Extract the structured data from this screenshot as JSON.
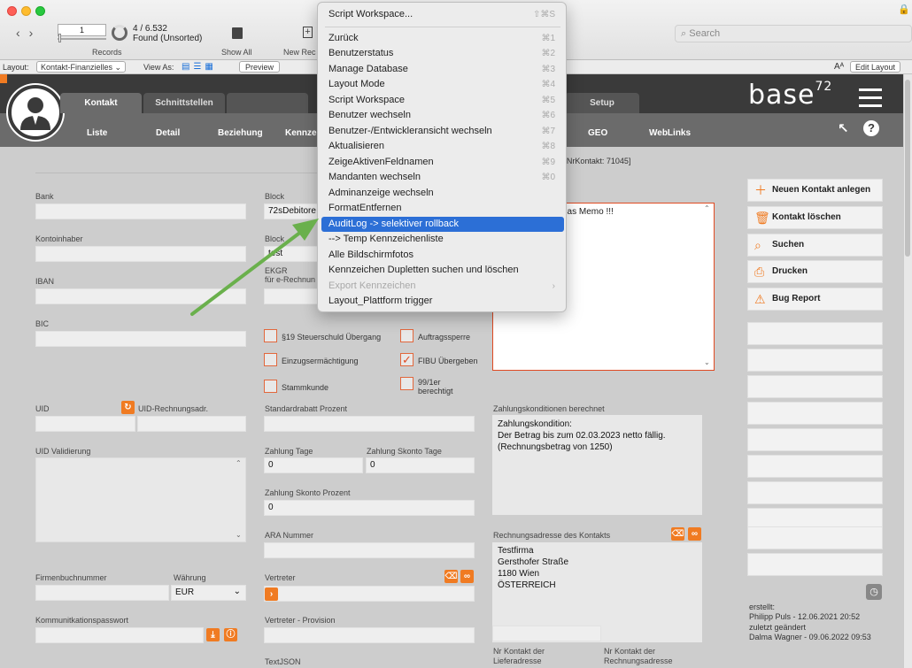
{
  "toolbar": {
    "record_number": "1",
    "records_label": "Records",
    "found_count": "4 / 6.532",
    "found_status": "Found (Unsorted)",
    "show_all_label": "Show All",
    "new_record_label": "New Rec",
    "search_placeholder": "Search"
  },
  "layoutbar": {
    "layout_label": "Layout:",
    "layout_value": "Kontakt-Finanzielles",
    "view_as_label": "View As:",
    "preview_label": "Preview",
    "aa_label": "Aᴬ",
    "edit_layout_label": "Edit Layout"
  },
  "header": {
    "tabs": [
      "Kontakt",
      "Schnittstellen",
      "Setup"
    ],
    "subnav": [
      "Liste",
      "Detail",
      "Beziehung",
      "Kennzei",
      "GEO",
      "WebLinks"
    ],
    "logo_text": "base",
    "logo_sup": "72"
  },
  "form": {
    "address_line": "aße • AT-1180 Wien [NrKontakt: 71045]",
    "bank_label": "Bank",
    "kontoinhaber_label": "Kontoinhaber",
    "iban_label": "IBAN",
    "bic_label": "BIC",
    "uid_label": "UID",
    "uid_rechnungsadr_label": "UID-Rechnungsadr.",
    "uid_validierung_label": "UID Validierung",
    "firmenbuchnummer_label": "Firmenbuchnummer",
    "waehrung_label": "Währung",
    "waehrung_value": "EUR",
    "kommunikationspasswort_label": "Kommunitkationspasswort",
    "block1_label": "Block",
    "block1_value": "72sDebitore",
    "block2_label": "Block",
    "block2_value": "test",
    "ekgr_label": "EKGR",
    "ekgr_sub_label": "für e-Rechnun",
    "cb_19_label": "§19 Steuerschuld Übergang",
    "cb_auftragssperre_label": "Auftragssperre",
    "cb_einzug_label": "Einzugsermächtigung",
    "cb_fibu_label": "FIBU Übergeben",
    "cb_stammkunde_label": "Stammkunde",
    "cb_9901_label": "99/1er",
    "cb_9901_sub_label": "berechtigt",
    "standardrabatt_label": "Standardrabatt Prozent",
    "zahlung_tage_label": "Zahlung Tage",
    "zahlung_tage_value": "0",
    "zahlung_skonto_tage_label": "Zahlung Skonto Tage",
    "zahlung_skonto_tage_value": "0",
    "zahlung_skonto_prozent_label": "Zahlung Skonto Prozent",
    "zahlung_skonto_prozent_value": "0",
    "ara_label": "ARA Nummer",
    "vertreter_label": "Vertreter",
    "vertreter_provision_label": "Vertreter - Provision",
    "textjson_label": "TextJSON",
    "memo_text": "das Memo !!!",
    "zahlungskonditionen_label": "Zahlungskonditionen berechnet",
    "zahlungskonditionen_lines": [
      "Zahlungskondition:",
      "Der Betrag bis zum 02.03.2023 netto fällig.",
      "(Rechnungsbetrag von 1250)"
    ],
    "rechnungsadresse_label": "Rechnungsadresse des Kontakts",
    "rechnungsadresse_lines": [
      "Testfirma",
      "Gersthofer Straße",
      "1180 Wien",
      "ÖSTERREICH"
    ],
    "nr_liefer_label_1": "Nr Kontakt der",
    "nr_liefer_label_2": "Lieferadresse",
    "nr_rech_label_1": "Nr Kontakt der",
    "nr_rech_label_2": "Rechnungsadresse"
  },
  "sidebar": {
    "new_contact": "Neuen Kontakt anlegen",
    "delete_contact": "Kontakt löschen",
    "search": "Suchen",
    "print": "Drucken",
    "bug_report": "Bug Report",
    "created_label": "erstellt:",
    "created_value": "Philipp Puls - 12.06.2021 20:52",
    "changed_label": "zuletzt geändert",
    "changed_value": "Dalma Wagner - 09.06.2022 09:53"
  },
  "menu": {
    "items": [
      {
        "label": "Script Workspace...",
        "shortcut": "⇧⌘S"
      },
      {
        "label": "Zurück",
        "shortcut": "⌘1"
      },
      {
        "label": "Benutzerstatus",
        "shortcut": "⌘2"
      },
      {
        "label": "Manage Database",
        "shortcut": "⌘3"
      },
      {
        "label": "Layout Mode",
        "shortcut": "⌘4"
      },
      {
        "label": "Script Workspace",
        "shortcut": "⌘5"
      },
      {
        "label": "Benutzer wechseln",
        "shortcut": "⌘6"
      },
      {
        "label": "Benutzer-/Entwickleransicht wechseln",
        "shortcut": "⌘7"
      },
      {
        "label": "Aktualisieren",
        "shortcut": "⌘8"
      },
      {
        "label": "ZeigeAktivenFeldnamen",
        "shortcut": "⌘9"
      },
      {
        "label": "Mandanten wechseln",
        "shortcut": "⌘0"
      },
      {
        "label": "Adminanzeige wechseln",
        "shortcut": ""
      },
      {
        "label": "FormatEntfernen",
        "shortcut": ""
      },
      {
        "label": "AuditLog -> selektiver rollback",
        "shortcut": ""
      },
      {
        "label": "--> Temp Kennzeichenliste",
        "shortcut": ""
      },
      {
        "label": "Alle Bildschirmfotos",
        "shortcut": ""
      },
      {
        "label": "Kennzeichen Dupletten suchen und löschen",
        "shortcut": ""
      },
      {
        "label": "Export Kennzeichen",
        "shortcut": "›"
      },
      {
        "label": "Layout_Plattform trigger",
        "shortcut": ""
      }
    ]
  },
  "colors": {
    "accent": "#f07b22",
    "menu_highlight": "#2c6fd6",
    "annotation_arrow": "#6ab04c"
  }
}
